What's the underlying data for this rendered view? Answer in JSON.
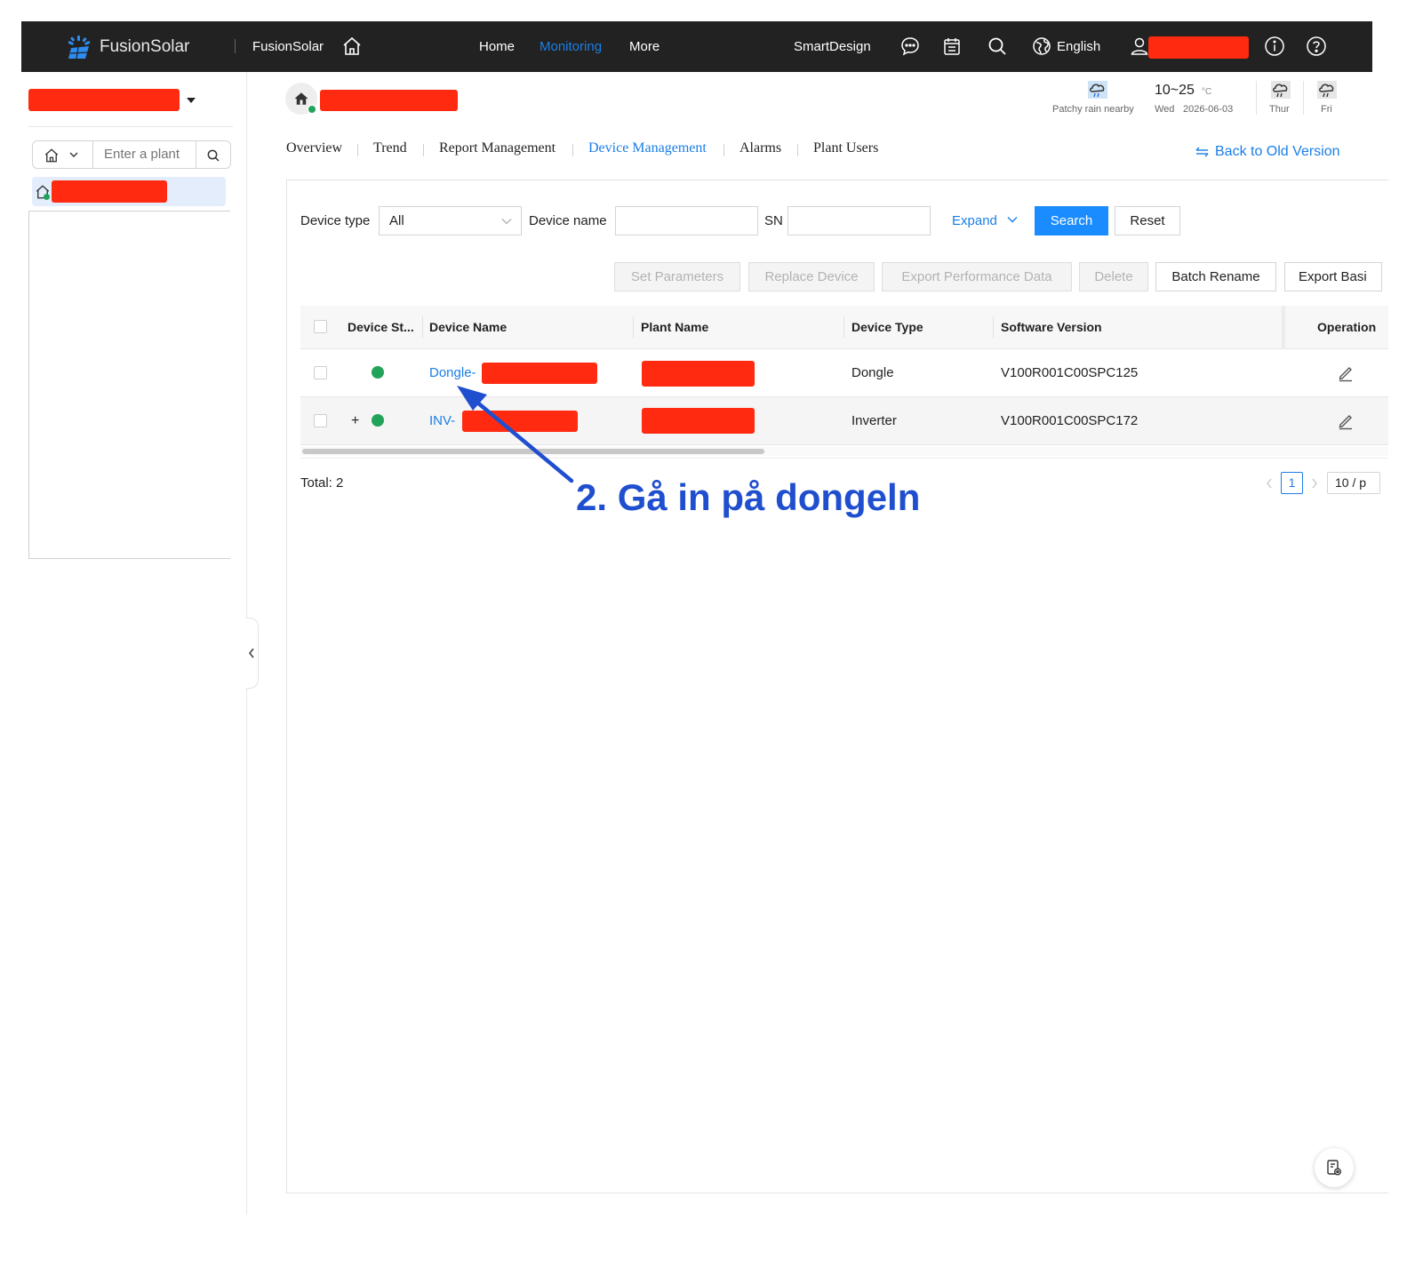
{
  "header": {
    "brand": "FusionSolar",
    "app_name": "FusionSolar",
    "nav": {
      "home": "Home",
      "monitoring": "Monitoring",
      "more": "More"
    },
    "smartdesign": "SmartDesign",
    "language": "English",
    "colors": {
      "bar": "#222222",
      "active": "#1a7ee6"
    }
  },
  "sidebar": {
    "search_placeholder": "Enter a plant"
  },
  "weather": {
    "today_desc": "Patchy rain nearby",
    "temp_range": "10~25",
    "temp_unit": "°C",
    "today_day": "Wed",
    "today_date": "2026-06-03",
    "day2": "Thur",
    "day3": "Fri"
  },
  "tabs": [
    {
      "label": "Overview"
    },
    {
      "label": "Trend"
    },
    {
      "label": "Report Management"
    },
    {
      "label": "Device Management",
      "active": true
    },
    {
      "label": "Alarms"
    },
    {
      "label": "Plant Users"
    }
  ],
  "back_old": "Back to Old Version",
  "filters": {
    "device_type_label": "Device type",
    "device_type_value": "All",
    "device_name_label": "Device name",
    "sn_label": "SN",
    "expand": "Expand",
    "search": "Search",
    "reset": "Reset"
  },
  "actions": {
    "set_parameters": "Set Parameters",
    "replace_device": "Replace Device",
    "export_perf": "Export Performance Data",
    "delete": "Delete",
    "batch_rename": "Batch Rename",
    "export_basic": "Export Basi"
  },
  "table": {
    "headers": {
      "status": "Device St...",
      "name": "Device Name",
      "plant": "Plant Name",
      "type": "Device Type",
      "software": "Software Version",
      "operation": "Operation"
    },
    "rows": [
      {
        "name": "Dongle-",
        "type": "Dongle",
        "software": "V100R001C00SPC125",
        "status_color": "#22a35a"
      },
      {
        "name": "INV-",
        "expander": "+",
        "type": "Inverter",
        "software": "V100R001C00SPC172",
        "status_color": "#22a35a"
      }
    ]
  },
  "pagination": {
    "total": "Total: 2",
    "page": "1",
    "page_size": "10 / p"
  },
  "annotation": {
    "text": "2. Gå in på dongeln",
    "color": "#1f4fcf"
  }
}
